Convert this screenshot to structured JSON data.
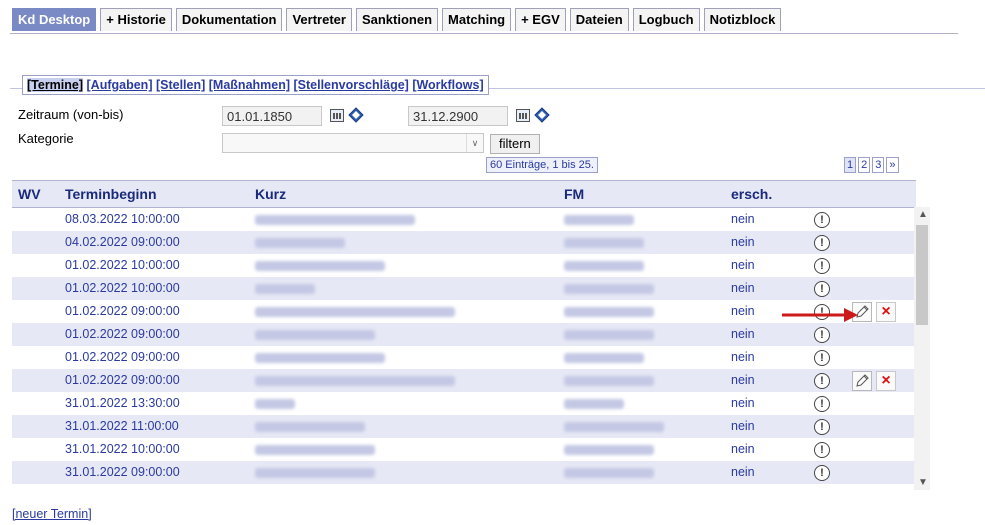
{
  "tabs": [
    "Kd Desktop",
    "+ Historie",
    "Dokumentation",
    "Vertreter",
    "Sanktionen",
    "Matching",
    "+ EGV",
    "Dateien",
    "Logbuch",
    "Notizblock"
  ],
  "subnav": [
    "[Termine]",
    "[Aufgaben]",
    "[Stellen]",
    "[Maßnahmen]",
    "[Stellenvorschläge]",
    "[Workflows]"
  ],
  "filter": {
    "zeitraum_label": "Zeitraum (von-bis)",
    "von": "01.01.1850",
    "bis": "31.12.2900",
    "kategorie_label": "Kategorie",
    "kategorie_value": "",
    "filter_button": "filtern",
    "count_text": "60 Einträge, 1 bis 25.",
    "pages": [
      "1",
      "2",
      "3",
      "»"
    ]
  },
  "table": {
    "headers": {
      "wv": "WV",
      "terminbeginn": "Terminbeginn",
      "kurz": "Kurz",
      "fm": "FM",
      "ersch": "ersch."
    },
    "rows": [
      {
        "terminbeginn": "08.03.2022 10:00:00",
        "ersch": "nein",
        "actions": false
      },
      {
        "terminbeginn": "04.02.2022 09:00:00",
        "ersch": "nein",
        "actions": false
      },
      {
        "terminbeginn": "01.02.2022 10:00:00",
        "ersch": "nein",
        "actions": false
      },
      {
        "terminbeginn": "01.02.2022 10:00:00",
        "ersch": "nein",
        "actions": false
      },
      {
        "terminbeginn": "01.02.2022 09:00:00",
        "ersch": "nein",
        "actions": true
      },
      {
        "terminbeginn": "01.02.2022 09:00:00",
        "ersch": "nein",
        "actions": false
      },
      {
        "terminbeginn": "01.02.2022 09:00:00",
        "ersch": "nein",
        "actions": false
      },
      {
        "terminbeginn": "01.02.2022 09:00:00",
        "ersch": "nein",
        "actions": true
      },
      {
        "terminbeginn": "31.01.2022 13:30:00",
        "ersch": "nein",
        "actions": false
      },
      {
        "terminbeginn": "31.01.2022 11:00:00",
        "ersch": "nein",
        "actions": false
      },
      {
        "terminbeginn": "31.01.2022 10:00:00",
        "ersch": "nein",
        "actions": false
      },
      {
        "terminbeginn": "31.01.2022 09:00:00",
        "ersch": "nein",
        "actions": false
      }
    ],
    "info_icon": "info-circle-icon",
    "edit_icon": "pencil-icon",
    "delete_icon": "close-x-icon"
  },
  "new_link": "[neuer Termin]",
  "colors": {
    "accent": "#7a8ac4",
    "row_alt": "#e6e8f5",
    "link": "#2a3aa0",
    "delete": "#e01010",
    "annotation_arrow": "#cc1a1a"
  }
}
